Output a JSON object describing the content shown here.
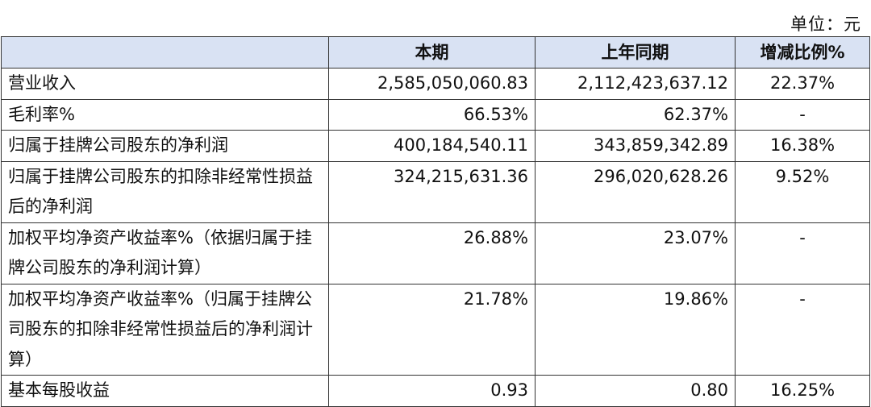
{
  "unit_label": "单位：元",
  "headers": [
    "",
    "本期",
    "上年同期",
    "增减比例%"
  ],
  "rows": [
    {
      "label": "营业收入",
      "current": "2,585,050,060.83",
      "previous": "2,112,423,637.12",
      "change": "22.37%"
    },
    {
      "label": "毛利率%",
      "current": "66.53%",
      "previous": "62.37%",
      "change": "-"
    },
    {
      "label": "归属于挂牌公司股东的净利润",
      "current": "400,184,540.11",
      "previous": "343,859,342.89",
      "change": "16.38%"
    },
    {
      "label": "归属于挂牌公司股东的扣除非经常性损益后的净利润",
      "current": "324,215,631.36",
      "previous": "296,020,628.26",
      "change": "9.52%"
    },
    {
      "label": "加权平均净资产收益率%（依据归属于挂牌公司股东的净利润计算）",
      "current": "26.88%",
      "previous": "23.07%",
      "change": "-"
    },
    {
      "label": "加权平均净资产收益率%（归属于挂牌公司股东的扣除非经常性损益后的净利润计算）",
      "current": "21.78%",
      "previous": "19.86%",
      "change": "-"
    },
    {
      "label": "基本每股收益",
      "current": "0.93",
      "previous": "0.80",
      "change": "16.25%"
    }
  ]
}
